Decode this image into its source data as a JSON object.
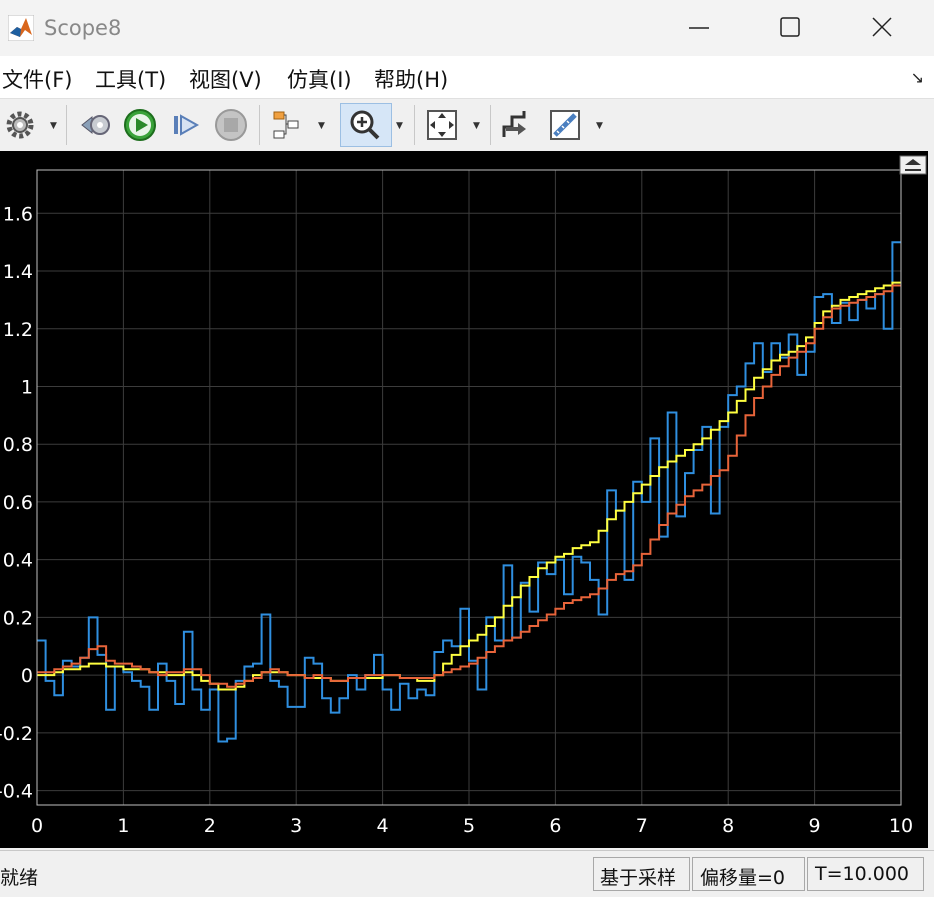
{
  "window": {
    "title": "Scope8"
  },
  "menu": [
    "文件(F)",
    "工具(T)",
    "视图(V)",
    "仿真(I)",
    "帮助(H)"
  ],
  "toolbar": [
    "settings-icon",
    "step-back-icon",
    "run-icon",
    "step-forward-icon",
    "stop-icon",
    "signal-selector-icon",
    "zoom-in-icon",
    "autoscale-icon",
    "triggers-icon",
    "measurements-icon"
  ],
  "status": {
    "state": "就绪",
    "mode": "基于采样",
    "offset": "偏移量=0",
    "time": "T=10.000"
  },
  "chart_data": {
    "type": "line",
    "style": "stairs",
    "xlim": [
      0,
      10
    ],
    "ylim": [
      -0.45,
      1.75
    ],
    "xticks": [
      "0",
      "1",
      "2",
      "3",
      "4",
      "5",
      "6",
      "7",
      "8",
      "9",
      "10"
    ],
    "yticks": [
      "-0.4",
      "-0.2",
      "0",
      "0.2",
      "0.4",
      "0.6",
      "0.8",
      "1",
      "1.2",
      "1.4",
      "1.6"
    ],
    "ytick_values": [
      -0.4,
      -0.2,
      0,
      0.2,
      0.4,
      0.6,
      0.8,
      1,
      1.2,
      1.4,
      1.6
    ],
    "grid": true,
    "background": "#000000",
    "series": [
      {
        "color": "#2f8fe0",
        "x": [
          0,
          0.1,
          0.2,
          0.3,
          0.4,
          0.5,
          0.6,
          0.7,
          0.8,
          0.9,
          1.0,
          1.1,
          1.2,
          1.3,
          1.4,
          1.5,
          1.6,
          1.7,
          1.8,
          1.9,
          2.0,
          2.1,
          2.2,
          2.3,
          2.4,
          2.5,
          2.6,
          2.7,
          2.8,
          2.9,
          3.0,
          3.1,
          3.2,
          3.3,
          3.4,
          3.5,
          3.6,
          3.7,
          3.8,
          3.9,
          4.0,
          4.1,
          4.2,
          4.3,
          4.4,
          4.5,
          4.6,
          4.7,
          4.8,
          4.9,
          5.0,
          5.1,
          5.2,
          5.3,
          5.4,
          5.5,
          5.6,
          5.7,
          5.8,
          5.9,
          6.0,
          6.1,
          6.2,
          6.3,
          6.4,
          6.5,
          6.6,
          6.7,
          6.8,
          6.9,
          7.0,
          7.1,
          7.2,
          7.3,
          7.4,
          7.5,
          7.6,
          7.7,
          7.8,
          7.9,
          8.0,
          8.1,
          8.2,
          8.3,
          8.4,
          8.5,
          8.6,
          8.7,
          8.8,
          8.9,
          9.0,
          9.1,
          9.2,
          9.3,
          9.4,
          9.5,
          9.6,
          9.7,
          9.8,
          9.9
        ],
        "y": [
          0.12,
          -0.02,
          -0.07,
          0.05,
          0.03,
          0.06,
          0.2,
          0.07,
          -0.12,
          0.03,
          0.01,
          -0.02,
          -0.04,
          -0.12,
          0.04,
          -0.02,
          -0.1,
          0.15,
          -0.05,
          -0.12,
          -0.05,
          -0.23,
          -0.22,
          -0.02,
          0.03,
          0.04,
          0.21,
          -0.02,
          -0.04,
          -0.11,
          -0.11,
          0.06,
          0.04,
          -0.08,
          -0.13,
          -0.08,
          0.0,
          -0.05,
          0.0,
          0.07,
          -0.05,
          -0.12,
          -0.03,
          -0.08,
          -0.05,
          -0.07,
          0.08,
          0.12,
          0.1,
          0.23,
          0.05,
          -0.05,
          0.2,
          0.12,
          0.38,
          0.13,
          0.32,
          0.22,
          0.39,
          0.35,
          0.4,
          0.28,
          0.41,
          0.39,
          0.33,
          0.21,
          0.64,
          0.57,
          0.33,
          0.67,
          0.6,
          0.82,
          0.48,
          0.91,
          0.55,
          0.7,
          0.78,
          0.86,
          0.56,
          0.86,
          0.97,
          1.0,
          1.08,
          1.15,
          1.05,
          1.15,
          1.1,
          1.18,
          1.04,
          1.12,
          1.31,
          1.32,
          1.22,
          1.29,
          1.23,
          1.3,
          1.27,
          1.32,
          1.2,
          1.5
        ]
      },
      {
        "color": "#ffff40",
        "x": [
          0,
          0.1,
          0.2,
          0.3,
          0.4,
          0.5,
          0.6,
          0.7,
          0.8,
          0.9,
          1.0,
          1.1,
          1.2,
          1.3,
          1.4,
          1.5,
          1.6,
          1.7,
          1.8,
          1.9,
          2.0,
          2.1,
          2.2,
          2.3,
          2.4,
          2.5,
          2.6,
          2.7,
          2.8,
          2.9,
          3.0,
          3.1,
          3.2,
          3.3,
          3.4,
          3.5,
          3.6,
          3.7,
          3.8,
          3.9,
          4.0,
          4.1,
          4.2,
          4.3,
          4.4,
          4.5,
          4.6,
          4.7,
          4.8,
          4.9,
          5.0,
          5.1,
          5.2,
          5.3,
          5.4,
          5.5,
          5.6,
          5.7,
          5.8,
          5.9,
          6.0,
          6.1,
          6.2,
          6.3,
          6.4,
          6.5,
          6.6,
          6.7,
          6.8,
          6.9,
          7.0,
          7.1,
          7.2,
          7.3,
          7.4,
          7.5,
          7.6,
          7.7,
          7.8,
          7.9,
          8.0,
          8.1,
          8.2,
          8.3,
          8.4,
          8.5,
          8.6,
          8.7,
          8.8,
          8.9,
          9.0,
          9.1,
          9.2,
          9.3,
          9.4,
          9.5,
          9.6,
          9.7,
          9.8,
          9.9
        ],
        "y": [
          0.0,
          0.0,
          0.01,
          0.02,
          0.02,
          0.03,
          0.04,
          0.04,
          0.03,
          0.03,
          0.02,
          0.02,
          0.02,
          0.01,
          0.01,
          0.0,
          0.0,
          0.01,
          0.0,
          -0.02,
          -0.03,
          -0.05,
          -0.05,
          -0.04,
          -0.02,
          0.0,
          0.01,
          0.01,
          0.01,
          0.0,
          0.0,
          -0.01,
          -0.01,
          -0.01,
          -0.02,
          -0.02,
          -0.01,
          -0.01,
          -0.01,
          -0.01,
          0.0,
          0.0,
          -0.01,
          -0.01,
          -0.02,
          -0.02,
          0.0,
          0.04,
          0.07,
          0.1,
          0.12,
          0.14,
          0.17,
          0.2,
          0.24,
          0.27,
          0.31,
          0.34,
          0.37,
          0.39,
          0.41,
          0.42,
          0.44,
          0.45,
          0.46,
          0.5,
          0.54,
          0.57,
          0.6,
          0.63,
          0.66,
          0.69,
          0.72,
          0.74,
          0.76,
          0.78,
          0.8,
          0.82,
          0.85,
          0.88,
          0.91,
          0.95,
          0.99,
          1.03,
          1.06,
          1.09,
          1.11,
          1.12,
          1.14,
          1.17,
          1.22,
          1.26,
          1.28,
          1.3,
          1.31,
          1.32,
          1.33,
          1.34,
          1.35,
          1.36
        ]
      },
      {
        "color": "#e8643a",
        "x": [
          0,
          0.1,
          0.2,
          0.3,
          0.4,
          0.5,
          0.6,
          0.7,
          0.8,
          0.9,
          1.0,
          1.1,
          1.2,
          1.3,
          1.4,
          1.5,
          1.6,
          1.7,
          1.8,
          1.9,
          2.0,
          2.1,
          2.2,
          2.3,
          2.4,
          2.5,
          2.6,
          2.7,
          2.8,
          2.9,
          3.0,
          3.1,
          3.2,
          3.3,
          3.4,
          3.5,
          3.6,
          3.7,
          3.8,
          3.9,
          4.0,
          4.1,
          4.2,
          4.3,
          4.4,
          4.5,
          4.6,
          4.7,
          4.8,
          4.9,
          5.0,
          5.1,
          5.2,
          5.3,
          5.4,
          5.5,
          5.6,
          5.7,
          5.8,
          5.9,
          6.0,
          6.1,
          6.2,
          6.3,
          6.4,
          6.5,
          6.6,
          6.7,
          6.8,
          6.9,
          7.0,
          7.1,
          7.2,
          7.3,
          7.4,
          7.5,
          7.6,
          7.7,
          7.8,
          7.9,
          8.0,
          8.1,
          8.2,
          8.3,
          8.4,
          8.5,
          8.6,
          8.7,
          8.8,
          8.9,
          9.0,
          9.1,
          9.2,
          9.3,
          9.4,
          9.5,
          9.6,
          9.7,
          9.8,
          9.9
        ],
        "y": [
          0.01,
          0.01,
          0.02,
          0.03,
          0.04,
          0.06,
          0.09,
          0.1,
          0.05,
          0.04,
          0.04,
          0.03,
          0.02,
          0.01,
          0.0,
          0.01,
          0.01,
          0.02,
          0.02,
          0.0,
          -0.03,
          -0.03,
          -0.04,
          -0.03,
          -0.02,
          -0.01,
          0.01,
          0.02,
          0.01,
          0.0,
          0.0,
          -0.01,
          0.0,
          -0.01,
          -0.02,
          -0.02,
          -0.01,
          -0.01,
          0.0,
          0.0,
          0.0,
          0.0,
          -0.01,
          -0.01,
          -0.01,
          -0.01,
          0.0,
          0.01,
          0.02,
          0.03,
          0.04,
          0.06,
          0.08,
          0.1,
          0.12,
          0.13,
          0.15,
          0.17,
          0.19,
          0.21,
          0.23,
          0.25,
          0.26,
          0.27,
          0.28,
          0.3,
          0.33,
          0.35,
          0.36,
          0.38,
          0.42,
          0.47,
          0.52,
          0.56,
          0.59,
          0.62,
          0.64,
          0.66,
          0.69,
          0.71,
          0.76,
          0.83,
          0.9,
          0.96,
          1.0,
          1.04,
          1.07,
          1.1,
          1.12,
          1.15,
          1.2,
          1.24,
          1.27,
          1.28,
          1.29,
          1.3,
          1.31,
          1.32,
          1.33,
          1.35
        ]
      }
    ]
  }
}
